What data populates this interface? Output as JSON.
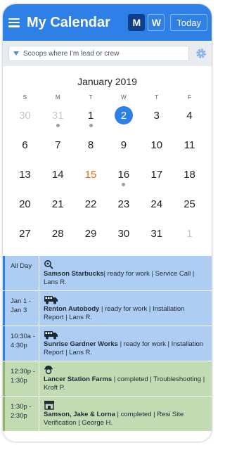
{
  "header": {
    "title": "My Calendar",
    "month_view_label": "M",
    "week_view_label": "W",
    "today_label": "Today"
  },
  "filter": {
    "text": "Scoops where I'm lead or crew"
  },
  "calendar": {
    "month_title": "January 2019",
    "days_of_week": [
      "S",
      "M",
      "T",
      "W",
      "T",
      "F"
    ],
    "weeks": [
      [
        {
          "n": "30",
          "muted": true
        },
        {
          "n": "31",
          "muted": true,
          "dot": true
        },
        {
          "n": "1",
          "dot": true
        },
        {
          "n": "2",
          "selected": true
        },
        {
          "n": "3"
        },
        {
          "n": "4"
        }
      ],
      [
        {
          "n": "6"
        },
        {
          "n": "7"
        },
        {
          "n": "8"
        },
        {
          "n": "9"
        },
        {
          "n": "10"
        },
        {
          "n": "11"
        }
      ],
      [
        {
          "n": "13"
        },
        {
          "n": "14"
        },
        {
          "n": "15",
          "today": true
        },
        {
          "n": "16",
          "dot": true
        },
        {
          "n": "17"
        },
        {
          "n": "18"
        }
      ],
      [
        {
          "n": "20"
        },
        {
          "n": "21"
        },
        {
          "n": "22"
        },
        {
          "n": "23"
        },
        {
          "n": "24"
        },
        {
          "n": "25"
        }
      ],
      [
        {
          "n": "27"
        },
        {
          "n": "28"
        },
        {
          "n": "29"
        },
        {
          "n": "30"
        },
        {
          "n": "31"
        },
        {
          "n": "1",
          "muted": true
        }
      ]
    ]
  },
  "events": [
    {
      "time": "All Day",
      "icon": "magnifier-gear-icon",
      "title": "Samson Starbucks",
      "detail": "| ready for work | Service Call | Lans  R.",
      "color": "blue"
    },
    {
      "time": "Jan 1 - Jan 3",
      "icon": "truck-icon",
      "title": "Renton Autobody",
      "detail": " | ready for work | Installation Report | Lans  R.",
      "color": "blue"
    },
    {
      "time": "10:30a - 4:30p",
      "icon": "truck-icon",
      "title": "Sunrise Gardner Works",
      "detail": " | ready for work | Installation Report | Lans R.",
      "color": "blue"
    },
    {
      "time": "12:30p - 1:30p",
      "icon": "worker-icon",
      "title": "Lancer Station Farms",
      "detail": " | completed | Troubleshooting | Kroft P.",
      "color": "green"
    },
    {
      "time": "1:30p - 2:30p",
      "icon": "storefront-icon",
      "title": "Samson, Jake & Lorna",
      "detail": " | completed | Resi Site Verification | George H.",
      "color": "green"
    }
  ],
  "colors": {
    "primary": "#2f80e6",
    "selected_view": "#0f3f8c",
    "today_text": "#e66a1a",
    "event_blue": "#aecdf2",
    "event_green": "#c2dbb2"
  }
}
